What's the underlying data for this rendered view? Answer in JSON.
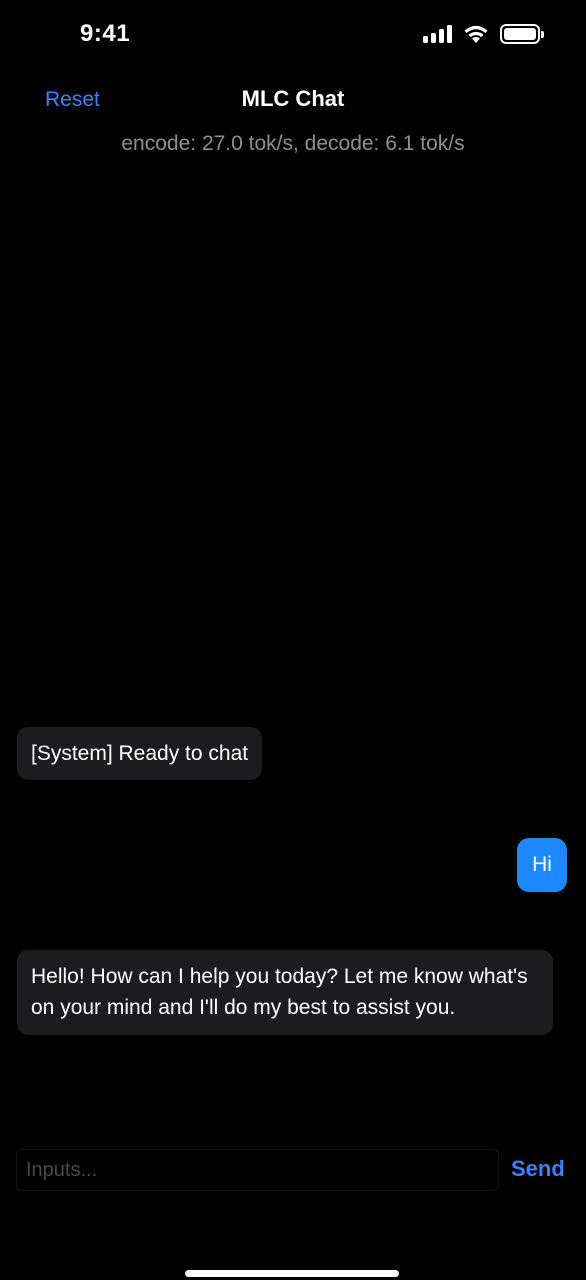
{
  "status_bar": {
    "time": "9:41",
    "icons": [
      "cellular-signal-icon",
      "wifi-icon",
      "battery-icon"
    ]
  },
  "nav": {
    "reset_label": "Reset",
    "title": "MLC Chat"
  },
  "speed_info": "encode: 27.0 tok/s, decode: 6.1 tok/s",
  "messages": [
    {
      "role": "system",
      "text": "[System] Ready to chat"
    },
    {
      "role": "user",
      "text": "Hi"
    },
    {
      "role": "assistant",
      "text": "Hello! How can I help you today? Let me know what's on your mind and I'll do my best to assist you."
    }
  ],
  "input": {
    "value": "",
    "placeholder": "Inputs..."
  },
  "send_label": "Send",
  "colors": {
    "background": "#000000",
    "accent": "#3b82f6",
    "user_bubble": "#1e88ff",
    "bot_bubble": "#1c1c1e",
    "secondary_text": "#8e8e93"
  }
}
